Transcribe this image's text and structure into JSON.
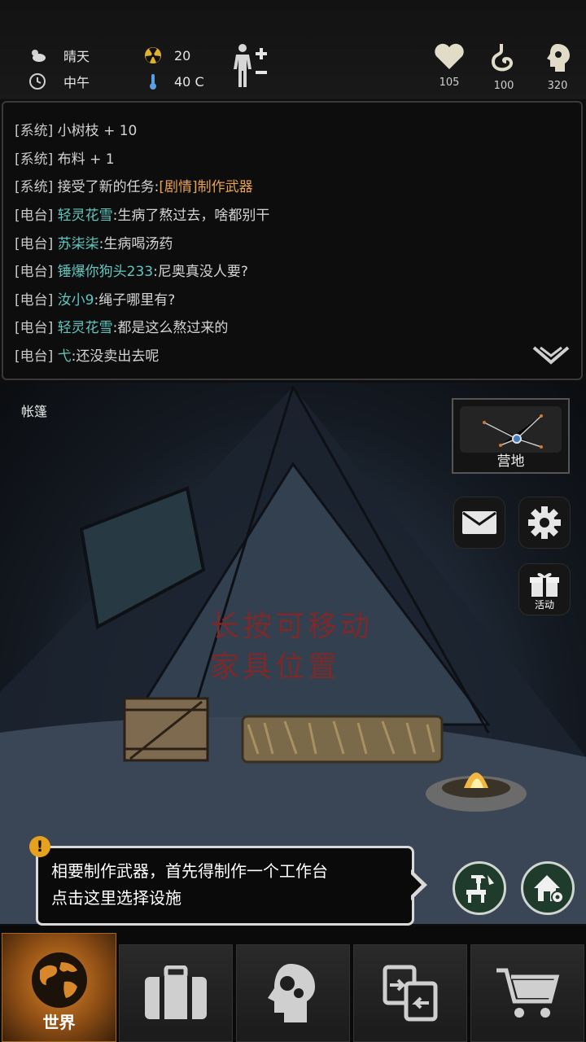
{
  "status": {
    "weather": "晴天",
    "time_of_day": "中午",
    "radiation": "20",
    "temperature": "40 C"
  },
  "vitals": [
    {
      "icon": "heart-icon",
      "value": "105"
    },
    {
      "icon": "stomach-icon",
      "value": "100"
    },
    {
      "icon": "mind-icon",
      "value": "320"
    }
  ],
  "log": [
    {
      "tag": "[系统]",
      "text": "小树枝 + 10"
    },
    {
      "tag": "[系统]",
      "text": "布料 + 1"
    },
    {
      "tag": "[系统]",
      "text": "接受了新的任务:",
      "quest": "[剧情]制作武器"
    },
    {
      "tag": "[电台]",
      "name": "轻灵花雪",
      "text": ":生病了熬过去，啥都别干"
    },
    {
      "tag": "[电台]",
      "name": "苏柒柒",
      "text": ":生病喝汤药"
    },
    {
      "tag": "[电台]",
      "name": "锤爆你狗头233",
      "text": ":尼奥真没人要?"
    },
    {
      "tag": "[电台]",
      "name": "汝小9",
      "text": ":绳子哪里有?"
    },
    {
      "tag": "[电台]",
      "name": "轻灵花雪",
      "text": ":都是这么熬过来的"
    },
    {
      "tag": "[电台]",
      "name": "弋",
      "text": ":还没卖出去呢"
    }
  ],
  "scene": {
    "location": "帐篷",
    "camp_label": "营地",
    "activity_label": "活动",
    "wall_text_1": "长按可移动",
    "wall_text_2": "家具位置"
  },
  "tooltip": {
    "badge": "!",
    "line1": "相要制作武器，首先得制作一个工作台",
    "line2": "点击这里选择设施"
  },
  "nav": {
    "world_label": "世界"
  },
  "colors": {
    "channel_name": "#5fc8c0",
    "quest": "#e7a24a",
    "world_tab": "#d9872b",
    "badge": "#e6a21f",
    "craft_button": "#1e3b2c"
  }
}
